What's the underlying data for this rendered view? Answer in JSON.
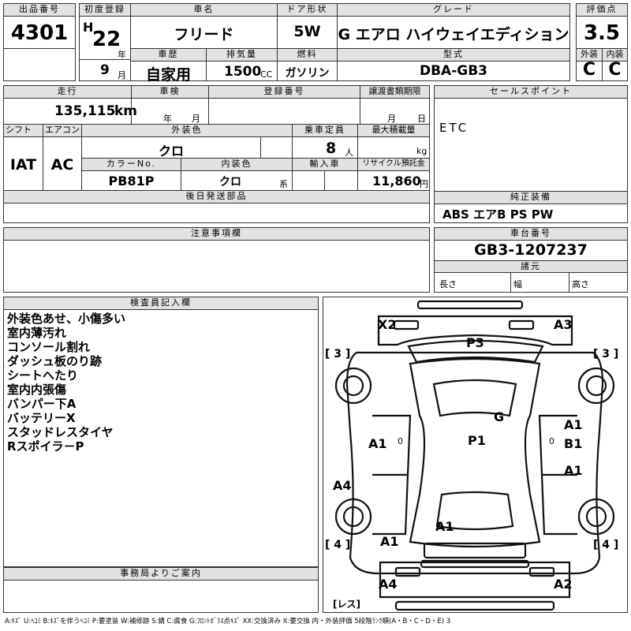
{
  "headers": {
    "lot_no": "出品番号",
    "first_reg": "初度登録",
    "car_name": "車名",
    "door": "ドア形状",
    "grade": "グレード",
    "score": "評価点",
    "history": "車歴",
    "displacement": "排気量",
    "fuel": "燃料",
    "model": "型式",
    "exterior": "外装",
    "interior": "内装",
    "mileage": "走行",
    "inspection": "車検",
    "reg_no": "登録番号",
    "transfer_deadline": "譲渡書類期限",
    "sales_point": "セールスポイント",
    "shift": "シフト",
    "aircon": "エアコン",
    "ext_color": "外装色",
    "capacity": "乗車定員",
    "max_load": "最大積載量",
    "color_no": "カラーNo.",
    "int_color": "内装色",
    "import": "輸入車",
    "recycle": "リサイクル預託金",
    "later_parts": "後日発送部品",
    "genuine_equip": "純正装備",
    "notes": "注意事項欄",
    "chassis_no": "車台番号",
    "specs": "諸元",
    "inspector": "検査員記入欄",
    "office": "事務局よりご案内"
  },
  "vehicle": {
    "lot_no": "4301",
    "era": "H",
    "year": "22",
    "year_unit": "年",
    "month": "9",
    "month_unit": "月",
    "car_name": "フリード",
    "door": "5W",
    "grade": "G エアロ ハイウェイエディション",
    "score": "3.5",
    "history": "自家用",
    "displacement": "1500",
    "displacement_unit": "CC",
    "fuel": "ガソリン",
    "model": "DBA-GB3",
    "exterior_grade": "C",
    "interior_grade": "C",
    "mileage": "135,115",
    "mileage_unit": "km",
    "inspection_year_unit": "年",
    "inspection_month_unit": "月",
    "deadline_month_unit": "月",
    "deadline_day_unit": "日",
    "sales_point": "ETC",
    "shift": "IAT",
    "aircon": "AC",
    "ext_color": "クロ",
    "capacity": "8",
    "capacity_unit": "人",
    "max_load_unit": "kg",
    "color_no": "PB81P",
    "int_color": "クロ",
    "int_color_unit": "系",
    "recycle": "11,860",
    "recycle_unit": "円",
    "genuine_equip": "ABS エアB PS PW",
    "chassis_no": "GB3-1207237",
    "spec_length": "長さ",
    "spec_width": "幅",
    "spec_height": "高さ"
  },
  "inspector_notes": [
    "外装色あせ、小傷多い",
    "室内薄汚れ",
    "コンソール割れ",
    "ダッシュ板のり跡",
    "シートへたり",
    "室内内張傷",
    "バンパー下A",
    "バッテリーX",
    "スタッドレスタイヤ",
    "Rスポイラ－P"
  ],
  "diagram": {
    "marks": {
      "x2": "X2",
      "a3_top": "A3",
      "p3": "P3",
      "g": "G",
      "p1": "P1",
      "a1_left_door": "A1",
      "a1_right_front": "A1",
      "b1_right": "B1",
      "a1_right_rear": "A1",
      "a4_left": "A4",
      "a1_bottom_center": "A1",
      "a1_bottom_left": "A1",
      "a4_bottom": "A4",
      "a2_bottom": "A2"
    },
    "tread": {
      "fl": "[ 3 ]",
      "fr": "[ 3 ]",
      "rl": "[ 4 ]",
      "rr": "[ 4 ]",
      "spare": "[レス]"
    }
  },
  "legend": "A:ｷｽﾞ U:ﾍｺﾐ B:ｷｽﾞを伴うﾍｺﾐ P:要塗装 W:補修跡 S:錆 C:腐食 G:ﾌﾛﾝﾄｶﾞﾗｽ点ｷｽﾞ XX:交換済み X:要交換 内・外装評価 5段階ﾗﾝｸ順(A・B・C・D・E) 3"
}
